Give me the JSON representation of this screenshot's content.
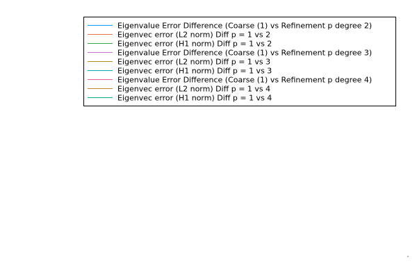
{
  "chart_data": {
    "type": "line",
    "title": "",
    "xlabel": "",
    "ylabel": "",
    "grid": false,
    "legend_position": "top-right",
    "series": [
      {
        "name": "Eigenvalue Error Difference (Coarse (1) vs Refinement p degree 2)",
        "color": "#009AFA",
        "values": []
      },
      {
        "name": "Eigenvec error (L2 norm) Diff p = 1 vs 2",
        "color": "#E36F47",
        "values": []
      },
      {
        "name": "Eigenvec error (H1 norm) Diff p = 1 vs 2",
        "color": "#3EA44E",
        "values": []
      },
      {
        "name": "Eigenvalue Error Difference (Coarse (1) vs Refinement p degree 3)",
        "color": "#C371D2",
        "values": []
      },
      {
        "name": "Eigenvec error (L2 norm) Diff p = 1 vs 3",
        "color": "#AC8E18",
        "values": []
      },
      {
        "name": "Eigenvec error (H1 norm) Diff p = 1 vs 3",
        "color": "#00A9AD",
        "values": []
      },
      {
        "name": "Eigenvalue Error Difference (Coarse (1) vs Refinement p degree 4)",
        "color": "#ED5E93",
        "values": []
      },
      {
        "name": "Eigenvec error (L2 norm) Diff p = 1 vs 4",
        "color": "#C68225",
        "values": []
      },
      {
        "name": "Eigenvec error (H1 norm) Diff p = 1 vs 4",
        "color": "#00A98D",
        "values": []
      }
    ]
  }
}
